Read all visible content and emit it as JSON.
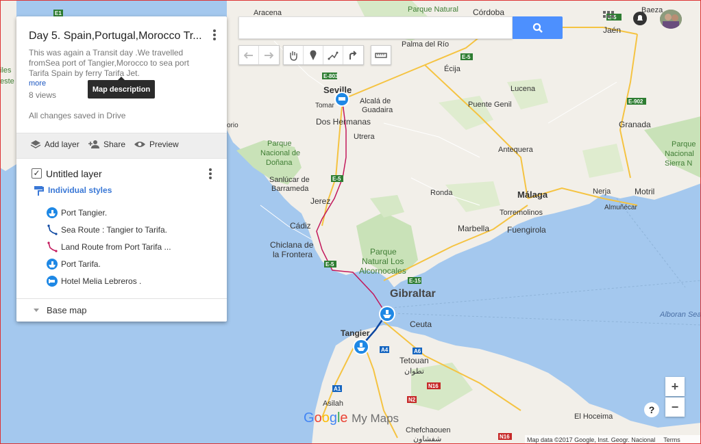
{
  "panel": {
    "title": "Day 5. Spain,Portugal,Morocco Tr...",
    "description": "This was again a Transit day .We travelled fromSea port of Tangier,Morocco to sea port Tarifa Spain by ferry Tarifa Jet.",
    "more": "more",
    "views": "8 views",
    "saved": "All changes saved in Drive",
    "tooltip": "Map description",
    "actions": {
      "add_layer": "Add layer",
      "share": "Share",
      "preview": "Preview"
    },
    "layer": {
      "title": "Untitled layer",
      "styles": "Individual styles",
      "items": [
        {
          "label": "Port Tangier.",
          "icon": "ferry-icon"
        },
        {
          "label": "Sea Route : Tangier to Tarifa.",
          "icon": "route-icon"
        },
        {
          "label": "Land Route from Port Tarifa ...",
          "icon": "route-icon"
        },
        {
          "label": "Port Tarifa.",
          "icon": "ferry-icon"
        },
        {
          "label": "Hotel Melia Lebreros .",
          "icon": "hotel-icon"
        }
      ]
    },
    "base_map": "Base map"
  },
  "search": {
    "placeholder": ""
  },
  "map": {
    "labels": {
      "aracena": "Aracena",
      "parque_natural_top": "Parque Natural",
      "cordoba": "Córdoba",
      "baeza": "Baeza",
      "jaen": "Jaén",
      "palma": "Palma del Río",
      "ecija": "Écija",
      "seville": "Seville",
      "tomares": "Tomar",
      "alcala": "Alcalá de",
      "guadaira": "Guadaira",
      "dos_hermanas": "Dos Hermanas",
      "utrera": "Utrera",
      "lucena": "Lucena",
      "puente_genil": "Puente Genil",
      "antequera": "Antequera",
      "granada": "Granada",
      "parque_donana1": "Parque",
      "parque_donana2": "Nacional de",
      "parque_donana3": "Doñana",
      "sanlucar1": "Sanlúcar de",
      "sanlucar2": "Barrameda",
      "jerez": "Jerez",
      "ronda": "Ronda",
      "malaga": "Málaga",
      "torremolinos": "Torremolinos",
      "marbella": "Marbella",
      "fuengirola": "Fuengirola",
      "nerja": "Nerja",
      "motril": "Motril",
      "almunecar": "Almuñécar",
      "cadiz": "Cádiz",
      "chiclana1": "Chiclana de",
      "chiclana2": "la Frontera",
      "alcornocales1": "Parque",
      "alcornocales2": "Natural Los",
      "alcornocales3": "Alcornocales",
      "gibraltar": "Gibraltar",
      "ceuta": "Ceuta",
      "tangier": "Tangier",
      "tetouan": "Tetouan",
      "tetouan_ar": "تطوان",
      "asilah": "Asilah",
      "chefchaouen": "Chefchaouen",
      "chefchaouen_ar": "شفشاون",
      "el_hoceima": "El Hoceima",
      "alboran": "Alboran Sea",
      "sierra1": "Parque",
      "sierra2": "Nacional",
      "sierra3": "Sierra N",
      "orio": "orio",
      "iles": "iles",
      "nuelva": "uelva",
      "estel": "este"
    },
    "road_labels": [
      "E-803",
      "E-5",
      "E-902",
      "E-5",
      "E-5",
      "E-15",
      "A4",
      "A6",
      "N16",
      "A1",
      "N2",
      "N16",
      "E1",
      "E-5"
    ]
  },
  "zoom": {
    "in": "+",
    "out": "−"
  },
  "help": "?",
  "logo": {
    "google": "Google",
    "mymaps": "My Maps"
  },
  "attribution": {
    "text": "Map data ©2017 Google, Inst. Geogr. Nacional",
    "terms": "Terms"
  }
}
